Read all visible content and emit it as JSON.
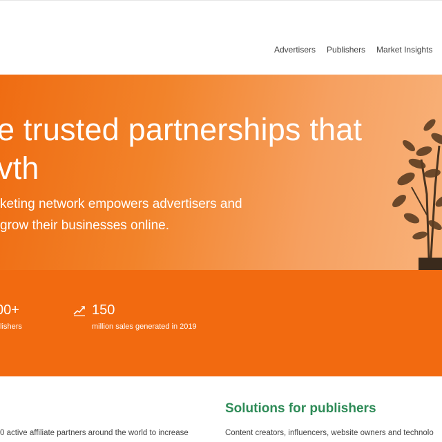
{
  "nav": {
    "items": [
      "Advertisers",
      "Publishers",
      "Market Insights"
    ]
  },
  "hero": {
    "title_line1": "e trusted partnerships that",
    "title_line2": "vth",
    "subtitle_line1": "keting network empowers advertisers and",
    "subtitle_line2": "grow their businesses online."
  },
  "stats": [
    {
      "value": "00+",
      "label": "blishers",
      "icon": ""
    },
    {
      "value": "150",
      "label": "million sales generated in 2019",
      "icon": "growth-chart-icon"
    }
  ],
  "sections": {
    "left_text": "0 active affiliate partners around the world to increase",
    "publishers_title": "Solutions for publishers",
    "publishers_text": "Content creators, influencers, website owners and technolo"
  },
  "colors": {
    "brand_orange": "#f26a10",
    "accent_green": "#2e8b57"
  }
}
